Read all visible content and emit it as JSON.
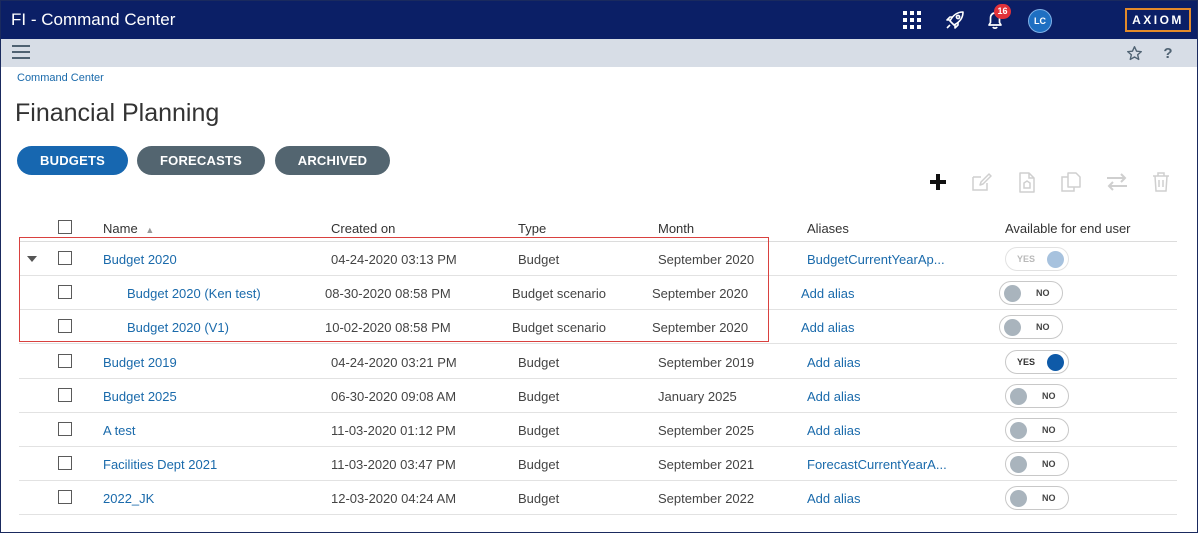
{
  "app": {
    "title": "FI - Command Center",
    "notification_count": "16",
    "avatar_initials": "LC",
    "logo": "AXIOM"
  },
  "colors": {
    "topbar": "#0b1f66",
    "subbar": "#d7dde6",
    "accent": "#1767b0",
    "tab_inactive": "#536570",
    "link": "#1a6aab",
    "logo_border": "#e38a2a",
    "highlight": "#d9413f"
  },
  "icons": [
    "apps-grid-icon",
    "rocket-icon",
    "bell-icon",
    "menu-icon",
    "star-icon",
    "help-icon",
    "plus-icon",
    "edit-icon",
    "document-icon",
    "copy-icon",
    "swap-icon",
    "trash-icon"
  ],
  "breadcrumb": "Command Center",
  "page_title": "Financial Planning",
  "tabs": [
    {
      "label": "BUDGETS",
      "active": true
    },
    {
      "label": "FORECASTS",
      "active": false
    },
    {
      "label": "ARCHIVED",
      "active": false
    }
  ],
  "table": {
    "headers": {
      "name": "Name",
      "created": "Created on",
      "type": "Type",
      "month": "Month",
      "aliases": "Aliases",
      "available": "Available for end user"
    },
    "rows": [
      {
        "name": "Budget 2020",
        "created": "04-24-2020 03:13 PM",
        "type": "Budget",
        "month": "September 2020",
        "alias": "BudgetCurrentYearAp...",
        "toggle": "YES",
        "state": "on-disabled"
      },
      {
        "name": "Budget 2020 (Ken test)",
        "created": "08-30-2020 08:58 PM",
        "type": "Budget scenario",
        "month": "September 2020",
        "alias": "Add alias",
        "toggle": "NO",
        "state": "off"
      },
      {
        "name": "Budget 2020 (V1)",
        "created": "10-02-2020 08:58 PM",
        "type": "Budget scenario",
        "month": "September 2020",
        "alias": "Add alias",
        "toggle": "NO",
        "state": "off"
      },
      {
        "name": "Budget 2019",
        "created": "04-24-2020 03:21 PM",
        "type": "Budget",
        "month": "September 2019",
        "alias": "Add alias",
        "toggle": "YES",
        "state": "on"
      },
      {
        "name": "Budget 2025",
        "created": "06-30-2020 09:08 AM",
        "type": "Budget",
        "month": "January 2025",
        "alias": "Add alias",
        "toggle": "NO",
        "state": "off"
      },
      {
        "name": "A test",
        "created": "11-03-2020 01:12 PM",
        "type": "Budget",
        "month": "September 2025",
        "alias": "Add alias",
        "toggle": "NO",
        "state": "off"
      },
      {
        "name": "Facilities Dept 2021",
        "created": "11-03-2020 03:47 PM",
        "type": "Budget",
        "month": "September 2021",
        "alias": "ForecastCurrentYearA...",
        "toggle": "NO",
        "state": "off"
      },
      {
        "name": "2022_JK",
        "created": "12-03-2020 04:24 AM",
        "type": "Budget",
        "month": "September 2022",
        "alias": "Add alias",
        "toggle": "NO",
        "state": "off"
      }
    ]
  }
}
